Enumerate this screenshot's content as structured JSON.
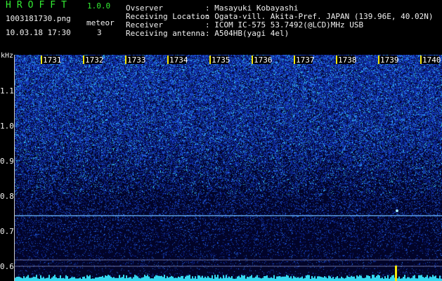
{
  "header": {
    "brand": "HROFFT",
    "version": "1.0.0",
    "filename": "1003181730.png",
    "datetime": "10.03.18 17:30",
    "meteor_label": "meteor",
    "meteor_count": "3",
    "fields": [
      {
        "label": "Ovserver",
        "value": ": Masayuki Kobayashi"
      },
      {
        "label": "Receiving Location",
        "value": ": Ogata-vill. Akita-Pref. JAPAN (139.96E, 40.02N)"
      },
      {
        "label": "Receiver",
        "value": ": ICOM IC-575 53.7492(@LCD)MHz USB"
      },
      {
        "label": "Receiving antenna",
        "value": ": A504HB(yagi 4el)"
      }
    ]
  },
  "spectrogram": {
    "y_unit": "kHz",
    "y_ticks": [
      "1.1",
      "1.0",
      "0.9",
      "0.8",
      "0.7",
      "0.6"
    ],
    "minute_labels": [
      "1731",
      "1732",
      "1733",
      "1734",
      "1735",
      "1736",
      "1737",
      "1738",
      "1739",
      "1740"
    ],
    "colors": {
      "background": "#000000",
      "noise_low": "#0a2a9a",
      "noise_high": "#39f0ff",
      "marker": "#f5e60a",
      "carrier": "#7fc8ff"
    }
  }
}
